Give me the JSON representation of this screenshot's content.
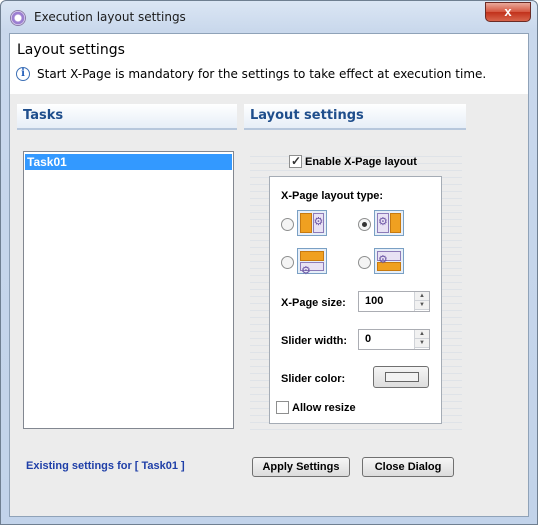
{
  "window": {
    "title": "Execution layout settings",
    "close_label": "x"
  },
  "header": {
    "title": "Layout settings",
    "info_text": "Start X-Page is mandatory for the settings to take effect at execution time."
  },
  "tasks": {
    "heading": "Tasks",
    "items": [
      "Task01"
    ],
    "selected": "Task01"
  },
  "layout": {
    "heading": "Layout settings",
    "enable_label": "Enable X-Page layout",
    "enable_checked": true,
    "type_label": "X-Page layout type:",
    "type_options": [
      {
        "name": "side-left",
        "checked": false
      },
      {
        "name": "side-right",
        "checked": true
      },
      {
        "name": "top",
        "checked": false
      },
      {
        "name": "bottom",
        "checked": false
      }
    ],
    "size_label": "X-Page size:",
    "size_value": "100",
    "slider_width_label": "Slider width:",
    "slider_width_value": "0",
    "slider_color_label": "Slider color:",
    "slider_color": "#f2f2f2",
    "allow_resize_label": "Allow resize",
    "allow_resize_checked": false
  },
  "footer": {
    "status_text": "Existing settings for [ Task01 ]",
    "apply_label": "Apply Settings",
    "close_label": "Close Dialog"
  },
  "colors": {
    "accent": "#1f4e8c",
    "selection": "#3399ff",
    "link": "#1f3fa8"
  }
}
